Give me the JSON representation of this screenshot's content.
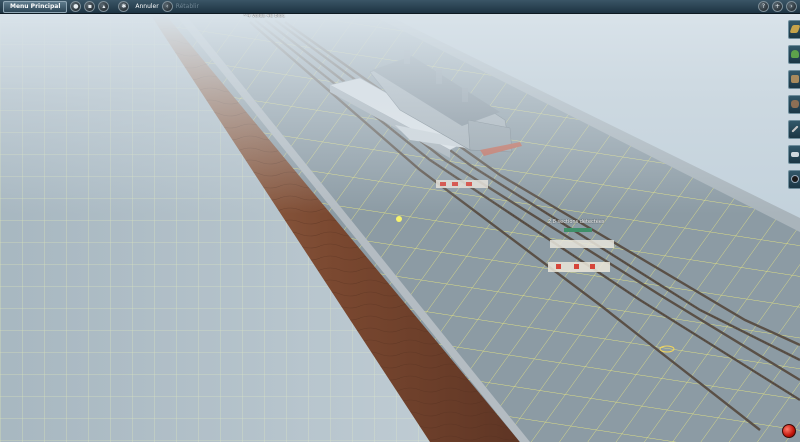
{
  "toolbar": {
    "menu_label": "Menu Principal",
    "undo_label": "Annuler",
    "redo_label": "Rétablir"
  },
  "scene_labels": {
    "top_label": "~4 voies 4e bloc",
    "track_label": "2,8 sections détectées"
  },
  "colors": {
    "toolbar_bg": "#23394a",
    "sky_fog": "#c5d3dc",
    "grid_ground": "#8fa2ad",
    "grid_lines": "#e9f17a",
    "wood_wall": "#7c4a33",
    "track": "#5b5148",
    "record_button": "#e0281a"
  },
  "icons": {
    "toolbar": [
      "globe-icon",
      "save-icon",
      "load-icon",
      "settings-icon"
    ],
    "sidebar": [
      "track-icon",
      "tree-icon",
      "building-icon",
      "figure-icon",
      "tool-icon",
      "layer-icon",
      "camera-icon"
    ],
    "top_right": [
      "help-icon",
      "add-icon",
      "arrow-icon"
    ]
  }
}
